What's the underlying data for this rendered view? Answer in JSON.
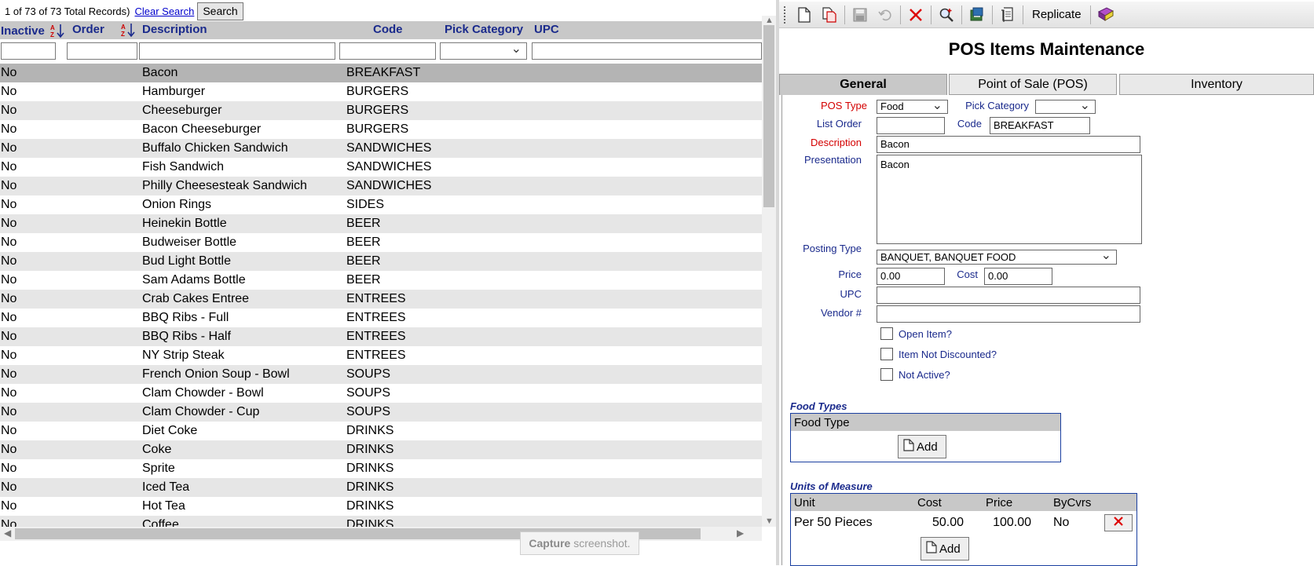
{
  "records": {
    "status": "1 of 73 of 73 Total Records)",
    "clear_search": "Clear Search",
    "search_button": "Search"
  },
  "grid": {
    "columns": {
      "inactive": "Inactive",
      "order": "Order",
      "description": "Description",
      "code": "Code",
      "pick_category": "Pick Category",
      "upc": "UPC"
    },
    "rows": [
      {
        "inactive": "No",
        "description": "Bacon",
        "code": "BREAKFAST"
      },
      {
        "inactive": "No",
        "description": "Hamburger",
        "code": "BURGERS"
      },
      {
        "inactive": "No",
        "description": "Cheeseburger",
        "code": "BURGERS"
      },
      {
        "inactive": "No",
        "description": "Bacon Cheeseburger",
        "code": "BURGERS"
      },
      {
        "inactive": "No",
        "description": "Buffalo Chicken Sandwich",
        "code": "SANDWICHES"
      },
      {
        "inactive": "No",
        "description": "Fish Sandwich",
        "code": "SANDWICHES"
      },
      {
        "inactive": "No",
        "description": "Philly Cheesesteak Sandwich",
        "code": "SANDWICHES"
      },
      {
        "inactive": "No",
        "description": "Onion Rings",
        "code": "SIDES"
      },
      {
        "inactive": "No",
        "description": "Heinekin Bottle",
        "code": "BEER"
      },
      {
        "inactive": "No",
        "description": "Budweiser Bottle",
        "code": "BEER"
      },
      {
        "inactive": "No",
        "description": "Bud Light Bottle",
        "code": "BEER"
      },
      {
        "inactive": "No",
        "description": "Sam Adams Bottle",
        "code": "BEER"
      },
      {
        "inactive": "No",
        "description": "Crab Cakes Entree",
        "code": "ENTREES"
      },
      {
        "inactive": "No",
        "description": "BBQ Ribs - Full",
        "code": "ENTREES"
      },
      {
        "inactive": "No",
        "description": "BBQ Ribs - Half",
        "code": "ENTREES"
      },
      {
        "inactive": "No",
        "description": "NY Strip Steak",
        "code": "ENTREES"
      },
      {
        "inactive": "No",
        "description": "French Onion Soup - Bowl",
        "code": "SOUPS"
      },
      {
        "inactive": "No",
        "description": "Clam Chowder - Bowl",
        "code": "SOUPS"
      },
      {
        "inactive": "No",
        "description": "Clam Chowder - Cup",
        "code": "SOUPS"
      },
      {
        "inactive": "No",
        "description": "Diet Coke",
        "code": "DRINKS"
      },
      {
        "inactive": "No",
        "description": "Coke",
        "code": "DRINKS"
      },
      {
        "inactive": "No",
        "description": "Sprite",
        "code": "DRINKS"
      },
      {
        "inactive": "No",
        "description": "Iced Tea",
        "code": "DRINKS"
      },
      {
        "inactive": "No",
        "description": "Hot Tea",
        "code": "DRINKS"
      },
      {
        "inactive": "No",
        "description": "Coffee",
        "code": "DRINKS"
      }
    ],
    "selected_row": 0
  },
  "capture_tip": {
    "bold": "Capture",
    "rest": " screenshot."
  },
  "toolbar": {
    "icons": [
      "new-icon",
      "copy-icon",
      "save-icon",
      "undo-icon",
      "delete-icon",
      "find-icon",
      "refresh-icon",
      "report-icon"
    ],
    "replicate_label": "Replicate",
    "help_icon": "book-icon"
  },
  "form": {
    "title": "POS Items Maintenance",
    "tabs": [
      "General",
      "Point of Sale (POS)",
      "Inventory"
    ],
    "active_tab": 0,
    "labels": {
      "pos_type": "POS Type",
      "pick_category": "Pick Category",
      "list_order": "List Order",
      "code": "Code",
      "description": "Description",
      "presentation": "Presentation",
      "posting_type": "Posting Type",
      "price": "Price",
      "cost": "Cost",
      "upc": "UPC",
      "vendor": "Vendor #",
      "open_item": "Open Item?",
      "item_not_discounted": "Item Not Discounted?",
      "not_active": "Not Active?"
    },
    "values": {
      "pos_type": "Food",
      "pick_category": "",
      "list_order": "",
      "code": "BREAKFAST",
      "description": "Bacon",
      "presentation": "Bacon",
      "posting_type": "BANQUET, BANQUET FOOD",
      "price": "0.00",
      "cost": "0.00",
      "upc": "",
      "vendor": ""
    },
    "food_types": {
      "title": "Food Types",
      "header": "Food Type",
      "add_label": "Add"
    },
    "units": {
      "title": "Units of Measure",
      "headers": {
        "unit": "Unit",
        "cost": "Cost",
        "price": "Price",
        "bycvrs": "ByCvrs"
      },
      "rows": [
        {
          "unit": "Per 50 Pieces",
          "cost": "50.00",
          "price": "100.00",
          "bycvrs": "No"
        }
      ],
      "add_label": "Add"
    }
  },
  "colors": {
    "label_blue": "#1a2a8c",
    "required_red": "#d40000",
    "grid_header": "#c8c8c8",
    "row_alt": "#e6e6e6",
    "row_selected": "#b4b4b4"
  }
}
